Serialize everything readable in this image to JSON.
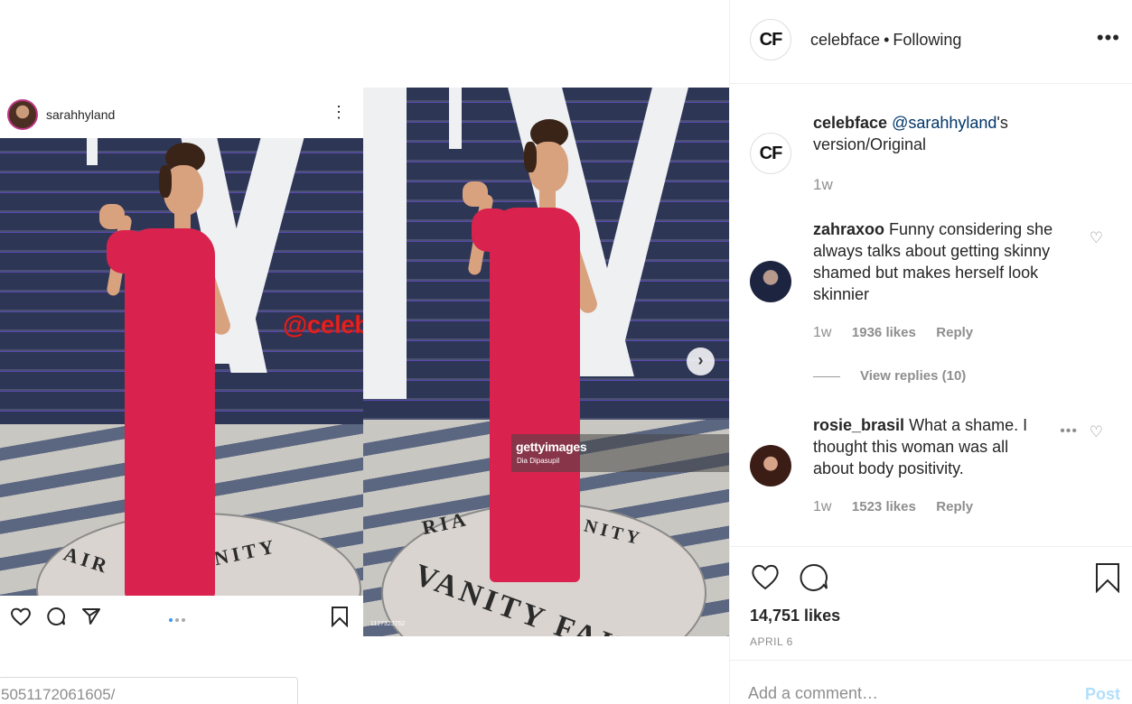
{
  "header": {
    "avatar_text": "CF",
    "username": "celebface",
    "separator": "•",
    "follow_status": "Following",
    "more_icon": "more-horizontal-icon"
  },
  "embedded_post": {
    "username": "sarahhyland",
    "watermark": "@celebface",
    "getty_logo": "gettyimages",
    "getty_credit": "Dia Dipasupil",
    "image_id": "1127323752",
    "url_fragment": "5051172061605/"
  },
  "comments": [
    {
      "avatar_text": "CF",
      "user": "celebface",
      "mention": "@sarahhyland",
      "text_after_mention": "'s version/Original",
      "time": "1w"
    },
    {
      "user": "zahraxoo",
      "text": "Funny considering she always talks about getting skinny shamed but makes herself look skinnier",
      "time": "1w",
      "likes": "1936 likes",
      "reply": "Reply",
      "view_replies": "View replies (10)"
    },
    {
      "user": "rosie_brasil",
      "text": "What a shame. I thought this woman was all about body positivity.",
      "time": "1w",
      "likes": "1523 likes",
      "reply": "Reply"
    }
  ],
  "post": {
    "likes": "14,751 likes",
    "date": "APRIL 6"
  },
  "comment_box": {
    "placeholder": "Add a comment…",
    "post_label": "Post"
  },
  "colors": {
    "accent_blue": "#3897f0",
    "post_disabled": "#b2dffc",
    "dress": "#d9234e",
    "watermark": "#e02424"
  }
}
